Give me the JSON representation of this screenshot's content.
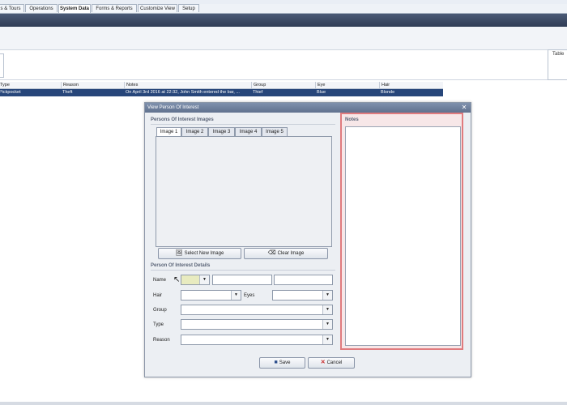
{
  "top_tabs": [
    "s & Tours",
    "Operations",
    "System Data",
    "Forms & Reports",
    "Customize View",
    "Setup"
  ],
  "toolbar": {
    "right_label": "Table"
  },
  "grid": {
    "headers": [
      "Type",
      "Reason",
      "Notes",
      "Group",
      "Eye",
      "Hair"
    ],
    "row": [
      "Pickpocket",
      "Theft",
      "On April 3rd 2016 at 22:32, John Smith entered the bar, ...",
      "Thief",
      "Blue",
      "Blonde"
    ]
  },
  "dialog": {
    "title": "View Person Of Interest",
    "close": "✕",
    "images_section": "Persons Of Interest Images",
    "image_tabs": [
      "Image 1",
      "Image 2",
      "Image 3",
      "Image 4",
      "Image 5"
    ],
    "select_image": "Select New Image",
    "clear_image": "Clear Image",
    "details_section": "Person Of Interest Details",
    "labels": {
      "name": "Name",
      "hair": "Hair",
      "eyes": "Eyes",
      "group": "Group",
      "type": "Type",
      "reason": "Reason"
    },
    "notes_label": "Notes",
    "save": "Save",
    "cancel": "Cancel",
    "dropdown_arrow": "▼"
  },
  "colors": {
    "selected_row": "#27467a",
    "highlight_border": "#e07b7e",
    "title_bar": "#6f82a0"
  }
}
